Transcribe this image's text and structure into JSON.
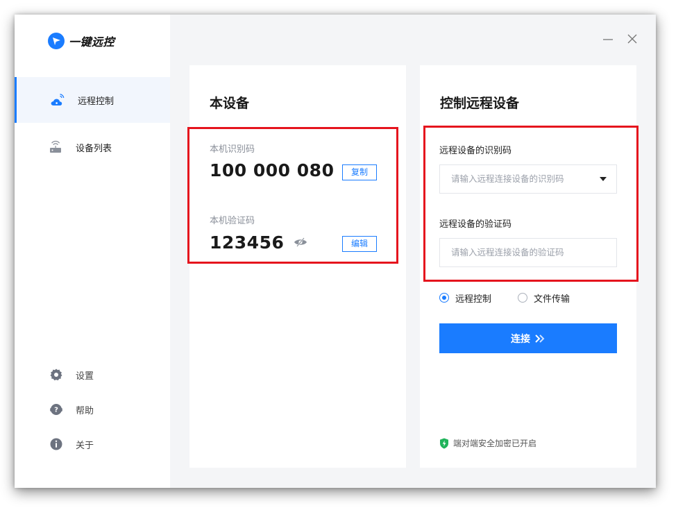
{
  "app": {
    "name": "一键远控"
  },
  "sidebar": {
    "nav": [
      {
        "label": "远程控制",
        "icon": "cloud-remote-icon",
        "active": true
      },
      {
        "label": "设备列表",
        "icon": "router-device-icon",
        "active": false
      }
    ],
    "bottom": [
      {
        "label": "设置",
        "icon": "gear-icon"
      },
      {
        "label": "帮助",
        "icon": "help-chat-icon"
      },
      {
        "label": "关于",
        "icon": "info-icon"
      }
    ]
  },
  "window_controls": {
    "minimize": "minimize-icon",
    "close": "close-icon"
  },
  "local_device": {
    "title": "本设备",
    "id_label": "本机识别码",
    "id_value": "100 000 080",
    "copy_label": "复制",
    "code_label": "本机验证码",
    "code_value": "123456",
    "edit_label": "编辑"
  },
  "remote": {
    "title": "控制远程设备",
    "id_label": "远程设备的识别码",
    "id_placeholder": "请输入远程连接设备的识别码",
    "code_label": "远程设备的验证码",
    "code_placeholder": "请输入远程连接设备的验证码",
    "modes": [
      {
        "label": "远程控制",
        "selected": true
      },
      {
        "label": "文件传输",
        "selected": false
      }
    ],
    "connect_label": "连接",
    "security_note": "端对端安全加密已开启"
  },
  "colors": {
    "accent": "#1a7cff",
    "highlight_box": "#e5141d",
    "security_green": "#1fb35a"
  }
}
